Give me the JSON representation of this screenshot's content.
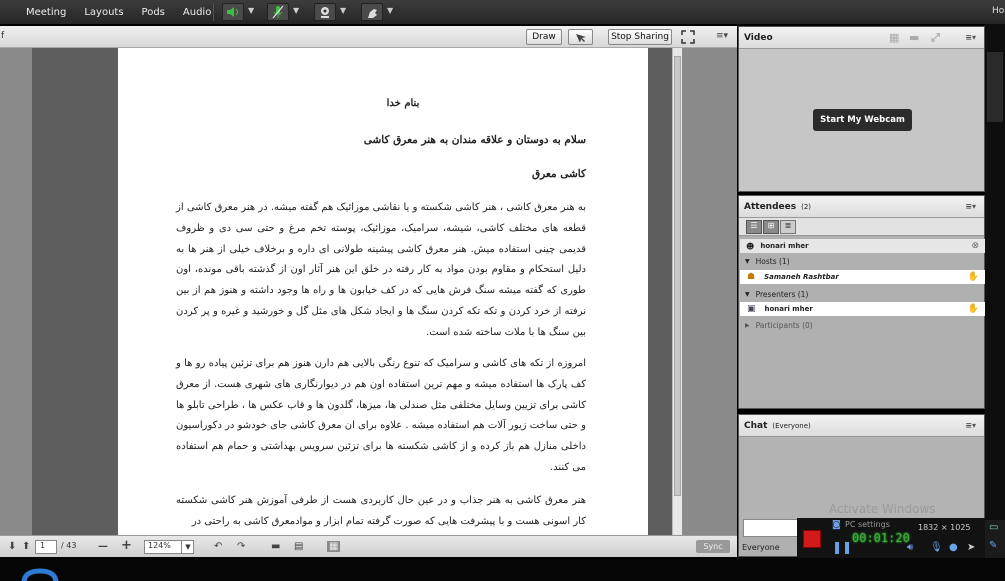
{
  "top_menu": {
    "items": [
      "Meeting",
      "Layouts",
      "Pods",
      "Audio"
    ],
    "right_clipped_label": "Ho"
  },
  "share_header": {
    "left_clipped_label": "f",
    "draw_label": "Draw",
    "stop_sharing_label": "Stop Sharing"
  },
  "document": {
    "lines": [
      "بنام خدا",
      "سلام به دوستان و علاقه مندان به هنر معرق کاشی",
      "کاشی معرق"
    ],
    "paragraphs": [
      "به هنر معرق کاشی ، هنر کاشی شکسته و یا نقاشی موزائیک هم گفته میشه. در هنر معرق کاشی از قطعه های مختلف کاشی، شیشه، سرامیک، موزائیک، پوسته تخم مرغ و حتی سی دی و ظروف قدیمی چینی استفاده میش. هنر معرق کاشی پیشینه طولانی ای داره و برخلاف خیلی از هنر ها به دلیل استحکام و مقاوم بودن مواد به کار رفته در خلق این هنر آثار اون از گذشته باقی مونده، اون طوری که گفته میشه سنگ فرش هایی که در کف خیابون ها و راه ها وجود داشته و هنوز هم از بین نرفته از خرد کردن و تکه تکه کردن سنگ ها و ایجاد شکل های مثل گل و خورشید و غیره و پر کردن بین سنگ ها با ملات ساخته شده است.",
      "امروزه از تکه های کاشی و سرامیک که تنوع رنگی بالایی هم دارن هنوز هم برای تزئین پیاده رو ها و کف پارک ها استفاده میشه و مهم ترین استفاده اون هم در دیوارنگاری های شهری هست. از معرق کاشی برای تزیین وسایل مختلفی مثل صندلی ها، میزها، گلدون ها و قاب عکس ها ، طراحی تابلو ها و حتی ساخت زیور آلات هم استفاده میشه . علاوه برای ان معرق کاشی جای خودشو در دکوراسیون داخلی منازل هم باز کرده و از کاشی شکسته ها برای تزئین سرویس بهداشتی و حمام هم استفاده می کنند.",
      "هنر معرق کاشی به هنر جذاب و در عین حال کاربردی هست از طرفی آموزش هنر کاشی شکسته کار اسونی هست و با پیشرفت هایی که صورت گرفته تمام ابزار و موادمعرق کاشی به راحتی در"
    ]
  },
  "footer": {
    "page_current": "1",
    "page_total": "/ 43",
    "zoom": "124%",
    "sync_label": "Sync"
  },
  "video_pod": {
    "title": "Video",
    "webcam_button": "Start My Webcam"
  },
  "attendees_pod": {
    "title": "Attendees",
    "count": "(2)",
    "current_user": "honari mher",
    "hosts_label": "Hosts (1)",
    "host_name": "Samaneh Rashtbar",
    "presenters_label": "Presenters (1)",
    "presenter_name": "honari mher",
    "participants_label": "Participants (0)"
  },
  "chat_pod": {
    "title": "Chat",
    "scope": "(Everyone)",
    "recipient": "Everyone"
  },
  "overlays": {
    "activate_windows": "Activate Windows",
    "pc_settings": "PC settings",
    "resolution": "1832 × 1025",
    "timer": "00:01:20"
  },
  "colors": {
    "speaker_green": "#3fbf3f",
    "record_red": "#d11a1a",
    "timer_green": "#4aa84a",
    "host_icon": "#d23b2b"
  }
}
